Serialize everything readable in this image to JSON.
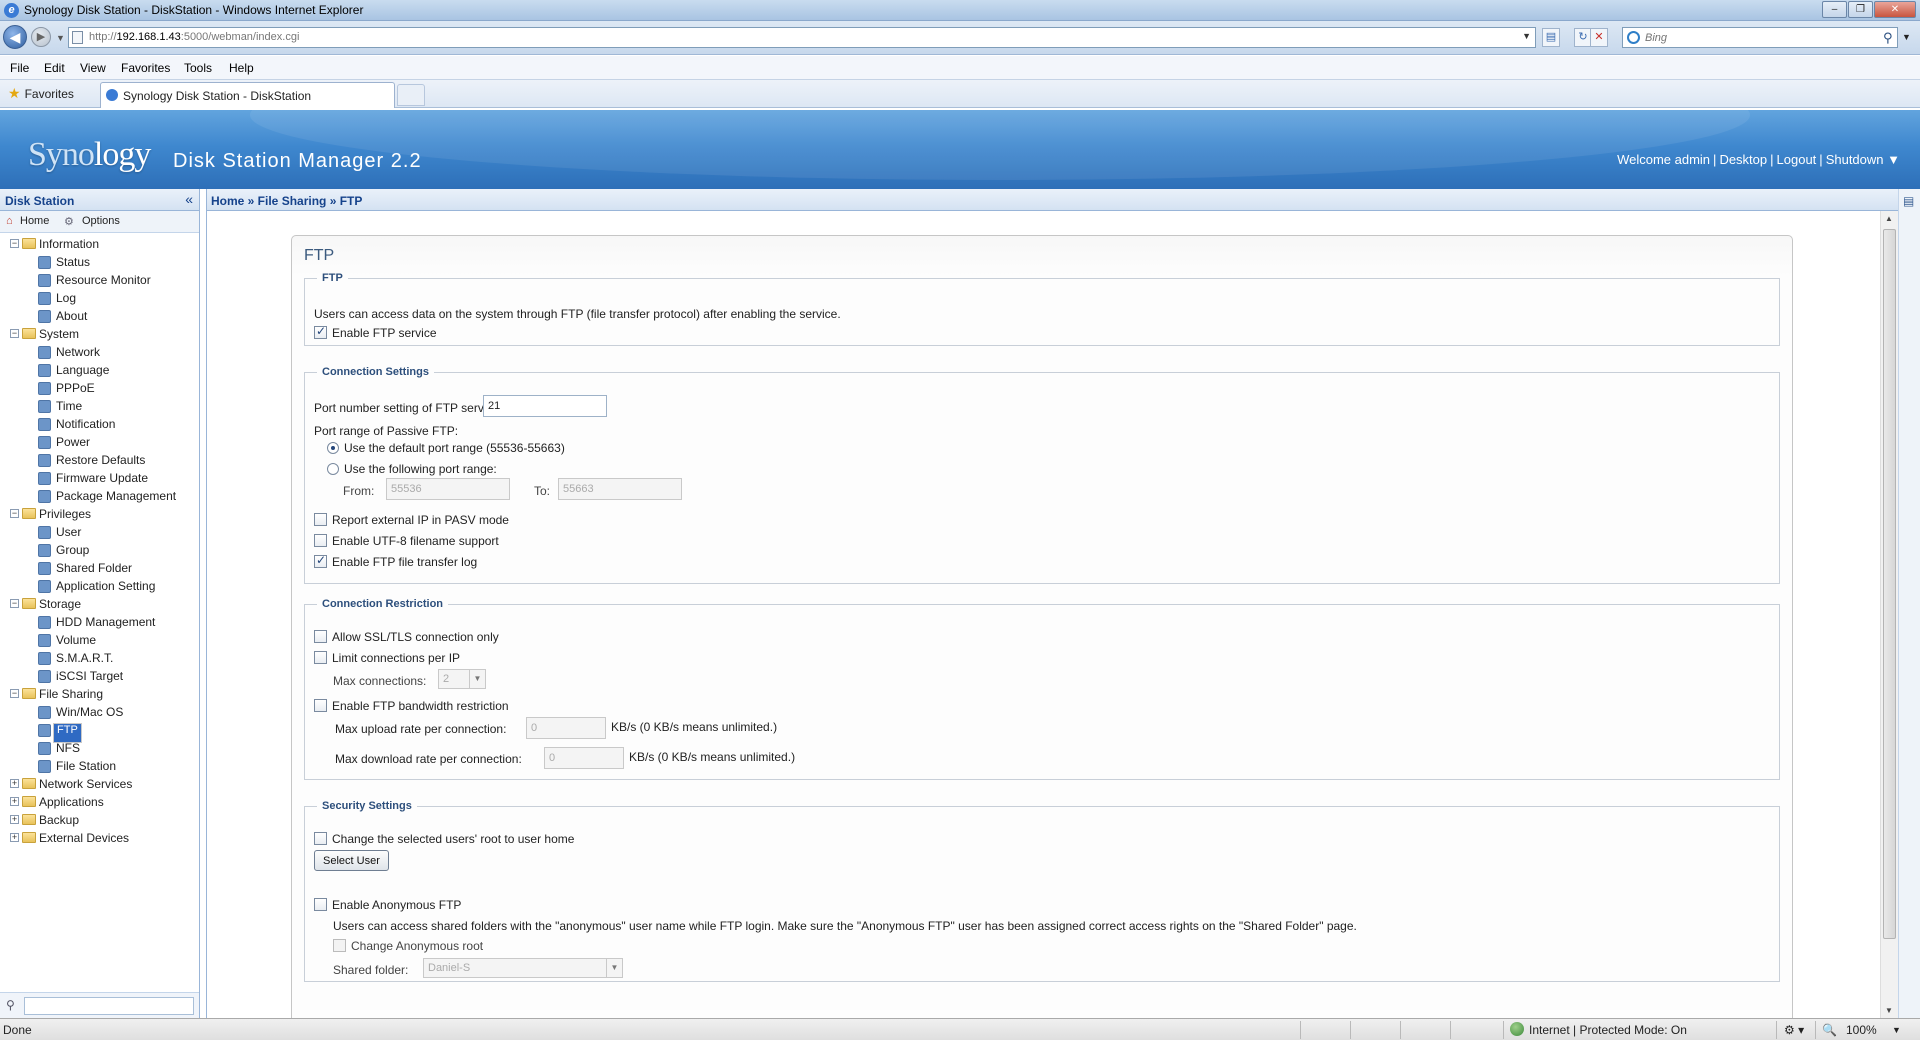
{
  "browser": {
    "window_title": "Synology Disk Station - DiskStation - Windows Internet Explorer",
    "url_prefix": "http://",
    "url_host": "192.168.1.43",
    "url_rest": ":5000/webman/index.cgi",
    "search_placeholder": "Bing",
    "menu": [
      "File",
      "Edit",
      "View",
      "Favorites",
      "Tools",
      "Help"
    ],
    "favorites_label": "Favorites",
    "tab_title": "Synology Disk Station - DiskStation",
    "status_left": "Done",
    "status_zone": "Internet | Protected Mode: On",
    "zoom": "100%"
  },
  "dsm": {
    "logo_a": "Syno",
    "logo_b": "logy",
    "product": "Disk Station Manager 2.2",
    "welcome": "Welcome admin",
    "desktop": "Desktop",
    "logout": "Logout",
    "shutdown": "Shutdown ▼"
  },
  "sidebar": {
    "title": "Disk Station",
    "collapse": "«",
    "home": "Home",
    "options": "Options",
    "tree": [
      {
        "label": "Information",
        "level": 0,
        "expanded": true
      },
      {
        "label": "Status",
        "level": 1
      },
      {
        "label": "Resource Monitor",
        "level": 1
      },
      {
        "label": "Log",
        "level": 1
      },
      {
        "label": "About",
        "level": 1
      },
      {
        "label": "System",
        "level": 0,
        "expanded": true
      },
      {
        "label": "Network",
        "level": 1
      },
      {
        "label": "Language",
        "level": 1
      },
      {
        "label": "PPPoE",
        "level": 1
      },
      {
        "label": "Time",
        "level": 1
      },
      {
        "label": "Notification",
        "level": 1
      },
      {
        "label": "Power",
        "level": 1
      },
      {
        "label": "Restore Defaults",
        "level": 1
      },
      {
        "label": "Firmware Update",
        "level": 1
      },
      {
        "label": "Package Management",
        "level": 1
      },
      {
        "label": "Privileges",
        "level": 0,
        "expanded": true
      },
      {
        "label": "User",
        "level": 1
      },
      {
        "label": "Group",
        "level": 1
      },
      {
        "label": "Shared Folder",
        "level": 1
      },
      {
        "label": "Application Setting",
        "level": 1
      },
      {
        "label": "Storage",
        "level": 0,
        "expanded": true
      },
      {
        "label": "HDD Management",
        "level": 1
      },
      {
        "label": "Volume",
        "level": 1
      },
      {
        "label": "S.M.A.R.T.",
        "level": 1
      },
      {
        "label": "iSCSI Target",
        "level": 1
      },
      {
        "label": "File Sharing",
        "level": 0,
        "expanded": true
      },
      {
        "label": "Win/Mac OS",
        "level": 1
      },
      {
        "label": "FTP",
        "level": 1,
        "selected": true
      },
      {
        "label": "NFS",
        "level": 1
      },
      {
        "label": "File Station",
        "level": 1
      },
      {
        "label": "Network Services",
        "level": 0,
        "expanded": false
      },
      {
        "label": "Applications",
        "level": 0,
        "expanded": false
      },
      {
        "label": "Backup",
        "level": 0,
        "expanded": false
      },
      {
        "label": "External Devices",
        "level": 0,
        "expanded": false
      }
    ]
  },
  "breadcrumb": "Home » File Sharing » FTP",
  "ftp": {
    "panel_title": "FTP",
    "section_ftp": {
      "legend": "FTP",
      "description": "Users can access data on the system through FTP (file transfer protocol) after enabling the service.",
      "enable_label": "Enable FTP service",
      "enable_checked": true
    },
    "connection": {
      "legend": "Connection Settings",
      "port_label": "Port number setting of FTP service:",
      "port_value": "21",
      "passive_label": "Port range of Passive FTP:",
      "default_range_label": "Use the default port range (55536-55663)",
      "default_range_selected": true,
      "custom_range_label": "Use the following port range:",
      "from_label": "From:",
      "from_value": "55536",
      "to_label": "To:",
      "to_value": "55663",
      "pasv_ip_label": "Report external IP in PASV mode",
      "pasv_ip_checked": false,
      "utf8_label": "Enable UTF-8 filename support",
      "utf8_checked": false,
      "log_label": "Enable FTP file transfer log",
      "log_checked": true
    },
    "restriction": {
      "legend": "Connection Restriction",
      "ssl_label": "Allow SSL/TLS connection only",
      "ssl_checked": false,
      "limit_label": "Limit connections per IP",
      "limit_checked": false,
      "max_conn_label": "Max connections:",
      "max_conn_value": "2",
      "bw_label": "Enable FTP bandwidth restriction",
      "bw_checked": false,
      "upload_label": "Max upload rate per connection:",
      "upload_value": "0",
      "upload_unit": "KB/s (0 KB/s means unlimited.)",
      "download_label": "Max download rate per connection:",
      "download_value": "0",
      "download_unit": "KB/s (0 KB/s means unlimited.)"
    },
    "security": {
      "legend": "Security Settings",
      "root_label": "Change the selected users' root to user home",
      "root_checked": false,
      "select_user_button": "Select User",
      "anon_label": "Enable Anonymous FTP",
      "anon_checked": false,
      "anon_desc": "Users can access shared folders with the \"anonymous\" user name while FTP login. Make sure the \"Anonymous FTP\" user has been assigned correct access rights on the \"Shared Folder\" page.",
      "anon_root_label": "Change Anonymous root",
      "shared_folder_label": "Shared folder:",
      "shared_folder_value": "Daniel-S"
    }
  }
}
